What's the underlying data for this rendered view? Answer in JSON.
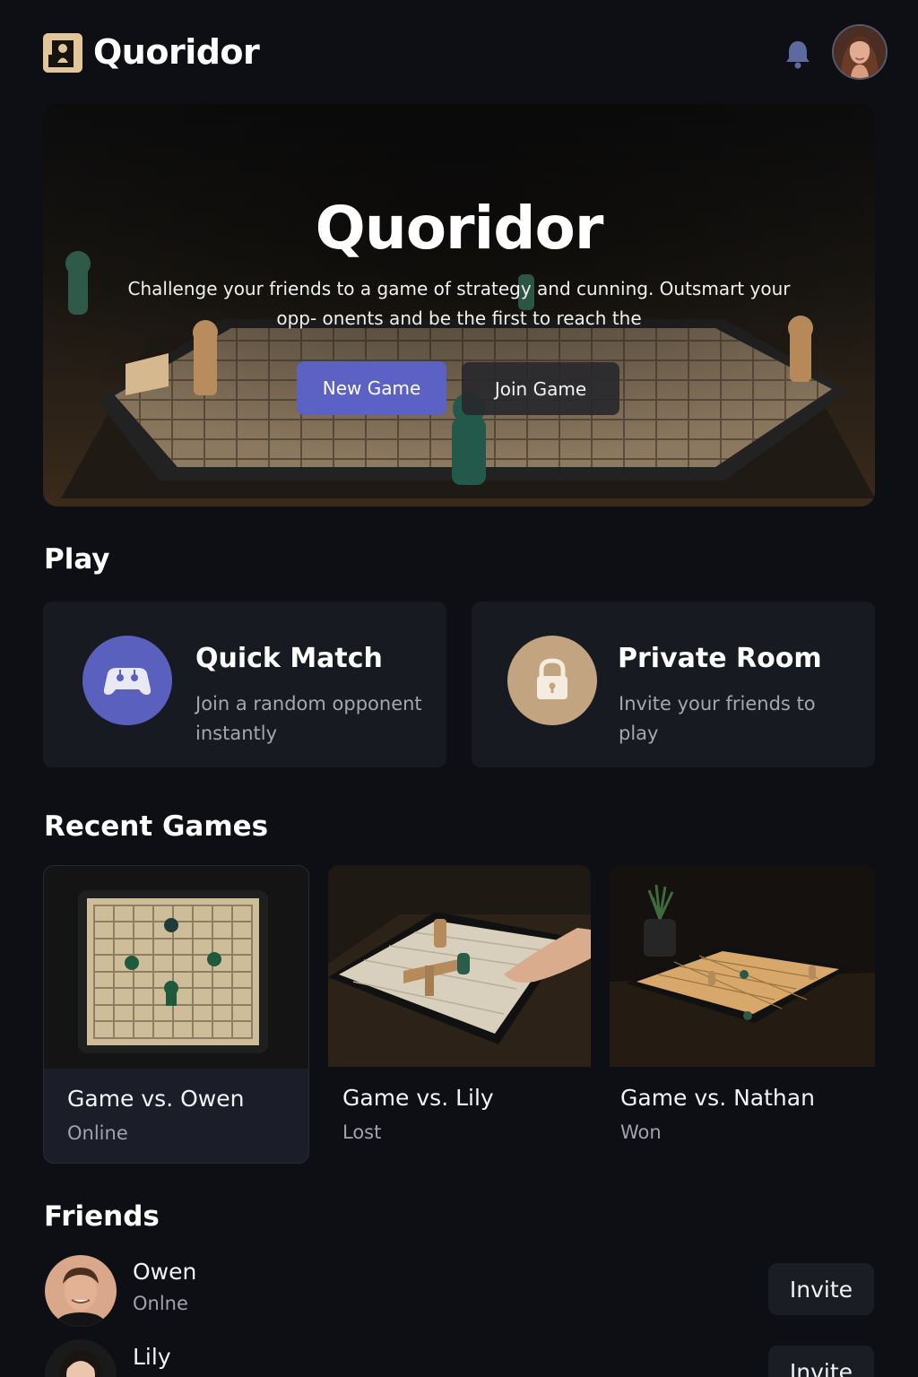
{
  "header": {
    "app_title": "Quoridor",
    "logo_icon": "pawn-logo-icon",
    "notification_icon": "bell-icon",
    "avatar_icon": "user-avatar"
  },
  "hero": {
    "title": "Quoridor",
    "description": "Challenge your friends to a game of strategy and cunning. Outsmart your opp- onents and be the  first to reach the",
    "new_game_label": "New Game",
    "join_game_label": "Join Game"
  },
  "play": {
    "heading": "Play",
    "cards": [
      {
        "title": "Quick Match",
        "subtitle": "Join a random opponent instantly",
        "icon": "gamepad-icon",
        "color": "#5a60bd"
      },
      {
        "title": "Private Room",
        "subtitle": "Invite your friends to play",
        "icon": "lock-icon",
        "color": "#c2a480"
      }
    ]
  },
  "recent": {
    "heading": "Recent Games",
    "games": [
      {
        "title": "Game vs. Owen",
        "status": "Online"
      },
      {
        "title": "Game vs. Lily",
        "status": "Lost"
      },
      {
        "title": "Game vs. Nathan",
        "status": "Won"
      }
    ]
  },
  "friends": {
    "heading": "Friends",
    "list": [
      {
        "name": "Owen",
        "status": "Onlne",
        "invite_label": "Invite"
      },
      {
        "name": "Lily",
        "status": "",
        "invite_label": "Invite"
      }
    ]
  },
  "colors": {
    "background": "#0e0f14",
    "card": "#181a22",
    "accent": "#5c62c4",
    "gold": "#c2a480"
  }
}
